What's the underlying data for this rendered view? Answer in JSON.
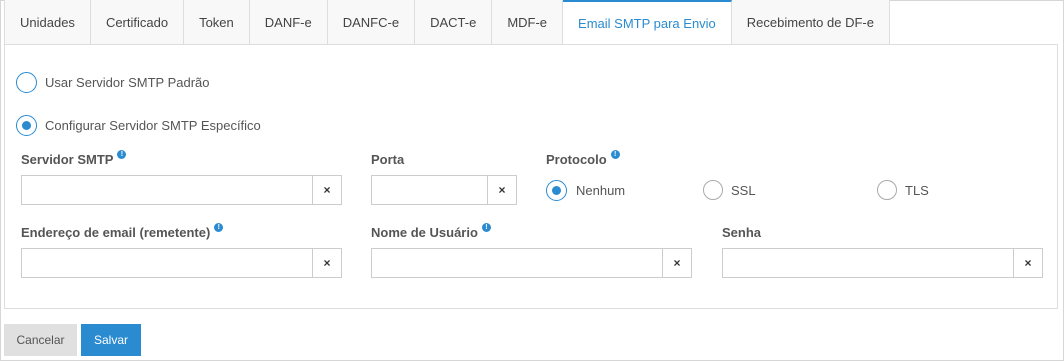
{
  "tabs": [
    {
      "label": "Unidades"
    },
    {
      "label": "Certificado"
    },
    {
      "label": "Token"
    },
    {
      "label": "DANF-e"
    },
    {
      "label": "DANFC-e"
    },
    {
      "label": "DACT-e"
    },
    {
      "label": "MDF-e"
    },
    {
      "label": "Email SMTP para Envio",
      "active": true
    },
    {
      "label": "Recebimento de DF-e"
    }
  ],
  "server_mode": {
    "default_label": "Usar Servidor SMTP Padrão",
    "specific_label": "Configurar Servidor SMTP Específico",
    "selected": "specific"
  },
  "fields": {
    "smtp_server": {
      "label": "Servidor SMTP",
      "value": ""
    },
    "port": {
      "label": "Porta",
      "value": ""
    },
    "protocol": {
      "label": "Protocolo",
      "options": [
        "Nenhum",
        "SSL",
        "TLS"
      ],
      "selected": "Nenhum"
    },
    "sender_email": {
      "label": "Endereço de email (remetente)",
      "value": ""
    },
    "username": {
      "label": "Nome de Usuário",
      "value": ""
    },
    "password": {
      "label": "Senha",
      "value": ""
    }
  },
  "icons": {
    "info": "info-icon",
    "clear": "×"
  },
  "buttons": {
    "cancel": "Cancelar",
    "save": "Salvar"
  },
  "colors": {
    "accent": "#2a8bd0",
    "cancel_bg": "#e0e0e0"
  }
}
